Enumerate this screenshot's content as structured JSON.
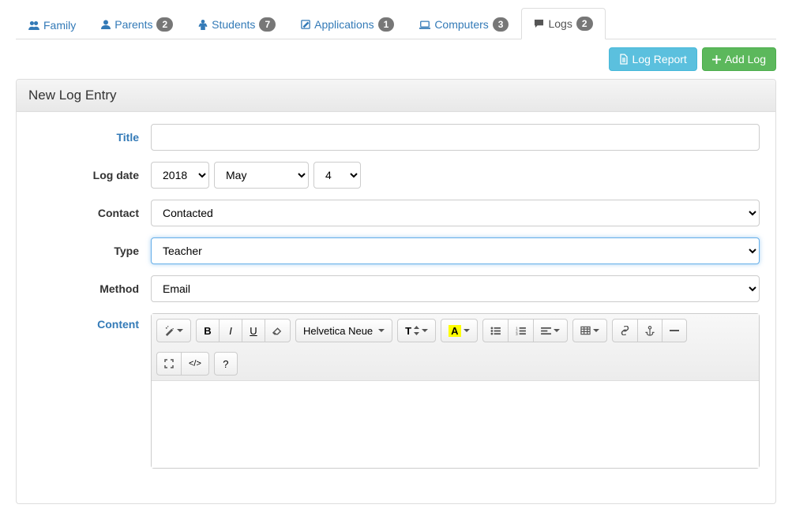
{
  "tabs": [
    {
      "label": "Family"
    },
    {
      "label": "Parents",
      "badge": "2"
    },
    {
      "label": "Students",
      "badge": "7"
    },
    {
      "label": "Applications",
      "badge": "1"
    },
    {
      "label": "Computers",
      "badge": "3"
    },
    {
      "label": "Logs",
      "badge": "2"
    }
  ],
  "actions": {
    "log_report": "Log Report",
    "add_log": "Add Log"
  },
  "panel": {
    "title": "New Log Entry"
  },
  "form": {
    "title_label": "Title",
    "title_value": "",
    "log_date_label": "Log date",
    "year": "2018",
    "month": "May",
    "day": "4",
    "contact_label": "Contact",
    "contact_value": "Contacted",
    "type_label": "Type",
    "type_value": "Teacher",
    "method_label": "Method",
    "method_value": "Email",
    "content_label": "Content"
  },
  "rte": {
    "font_name": "Helvetica Neue",
    "font_letter": "A",
    "paragraph": "T",
    "sub": "↕",
    "code": "</>",
    "help": "?"
  }
}
